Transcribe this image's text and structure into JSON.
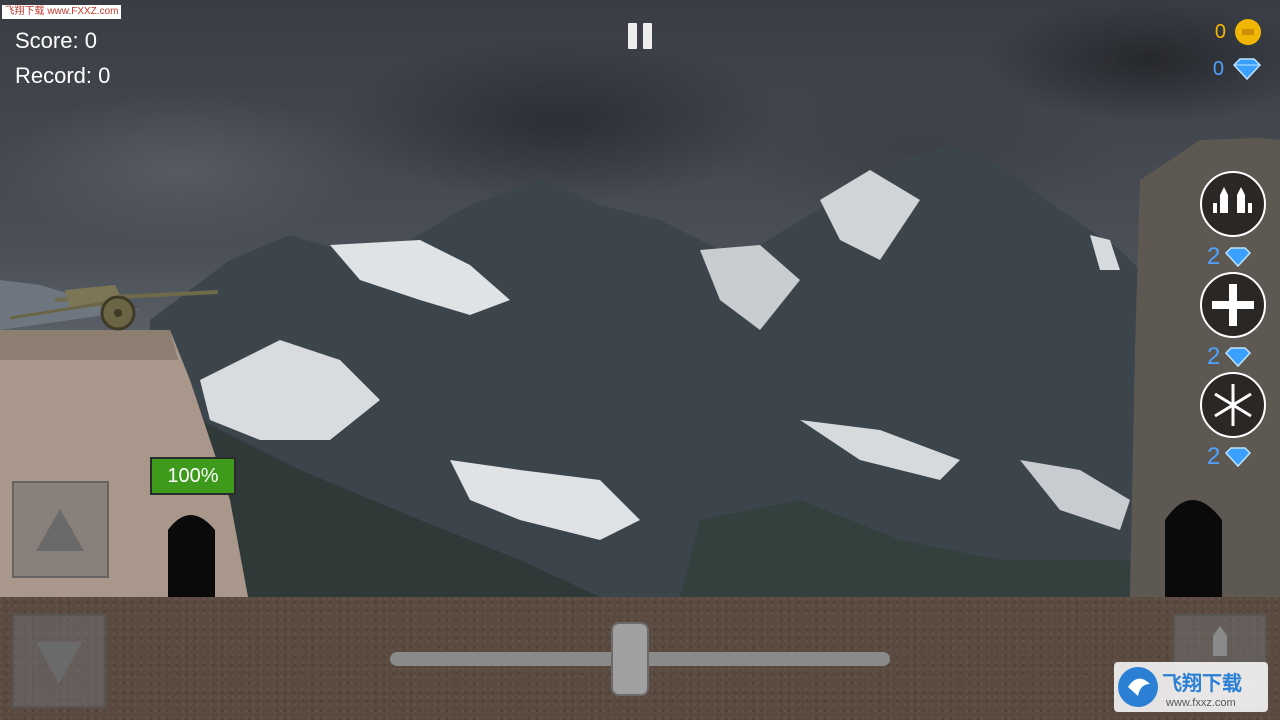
{
  "hud": {
    "score_label": "Score: 0",
    "record_label": "Record: 0",
    "coins": "0",
    "diamonds": "0"
  },
  "powerups": [
    {
      "name": "missiles",
      "cost": "2",
      "icon": "missiles-icon"
    },
    {
      "name": "repair",
      "cost": "2",
      "icon": "plus-icon"
    },
    {
      "name": "freeze",
      "cost": "2",
      "icon": "snowflake-icon"
    }
  ],
  "player": {
    "health_text": "100%",
    "health": 1.0
  },
  "controls": {
    "aim_slider_value": 0.48
  },
  "colors": {
    "coin": "#f2b705",
    "diamond": "#4fa3ff",
    "health": "#3d9a1a"
  },
  "watermark": {
    "top_text": "飞翔下载 www.FXXZ.com",
    "brand": "飞翔下载",
    "url": "www.fxxz.com"
  }
}
